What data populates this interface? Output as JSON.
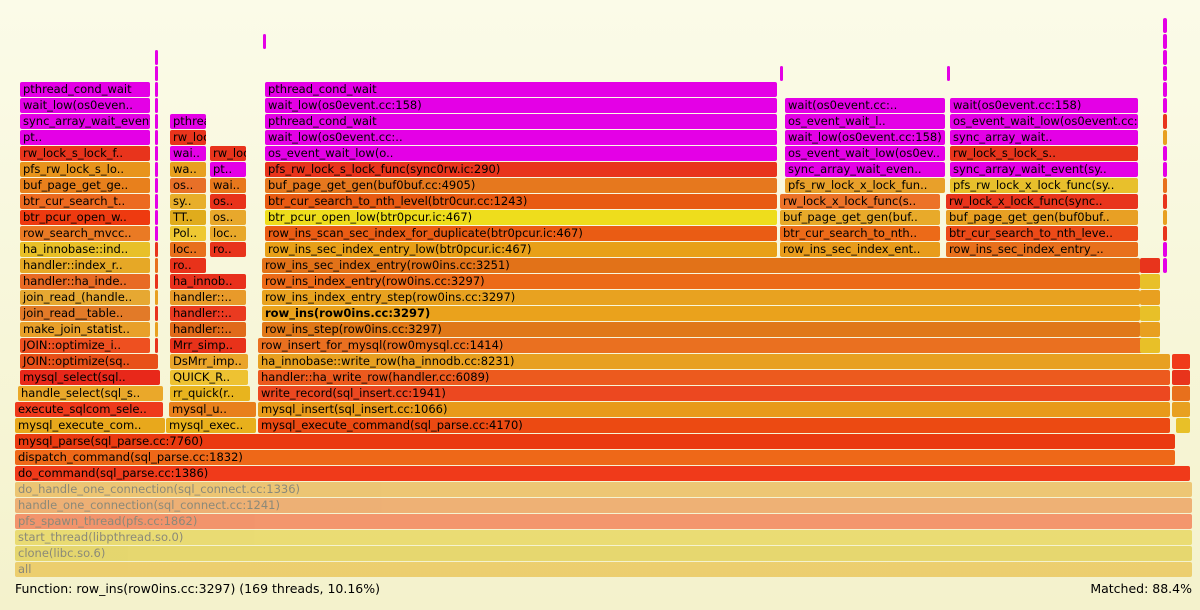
{
  "colors": {
    "magenta": "#e400e6",
    "red": "#e8341c",
    "orange_red": "#ef5a10",
    "orange": "#e8752c",
    "dark_orange": "#e06a12",
    "amber": "#e8a21e",
    "yellow": "#e8d020",
    "bright_red": "#f03822",
    "light_orange": "#e6964e"
  },
  "frames": [
    {
      "label": "all",
      "color": "#e6b020",
      "faded": true
    },
    {
      "label": "clone(libc.so.6)",
      "color": "#d8c020",
      "faded": true
    },
    {
      "label": "start_thread(libpthread.so.0)",
      "color": "#e0c828",
      "faded": true
    },
    {
      "label": "pfs_spawn_thread(pfs.cc:1862)",
      "color": "#f0481c",
      "faded": true
    },
    {
      "label": "handle_one_connection(sql_connect.cc:1241)",
      "color": "#e87a2a",
      "faded": true
    },
    {
      "label": "do_handle_one_connection(sql_connect.cc:1336)",
      "color": "#e6a028",
      "faded": true
    },
    {
      "label": "do_command(sql_parse.cc:1386)",
      "color": "#f03a1a"
    },
    {
      "label": "dispatch_command(sql_parse.cc:1832)",
      "color": "#ee6818"
    },
    {
      "label": "mysql_parse(sql_parse.cc:7760)",
      "color": "#ea3a10"
    },
    {
      "label": "mysql_execute_com..",
      "color": "#e8a81c"
    },
    {
      "label": "mysql_exec..",
      "color": "#e8b01c"
    },
    {
      "label": "mysql_execute_command(sql_parse.cc:4170)",
      "color": "#ec4a12"
    },
    {
      "label": "execute_sqlcom_sele..",
      "color": "#ee3a1c"
    },
    {
      "label": "mysql_u..",
      "color": "#e8801c"
    },
    {
      "label": "mysql_insert(sql_insert.cc:1066)",
      "color": "#e89a1a"
    },
    {
      "label": "handle_select(sql_s..",
      "color": "#eaa82a"
    },
    {
      "label": "rr_quick(r..",
      "color": "#e8b41e"
    },
    {
      "label": "write_record(sql_insert.cc:1941)",
      "color": "#ec4820"
    },
    {
      "label": "mysql_select(sql..",
      "color": "#e8281a"
    },
    {
      "label": "QUICK_R..",
      "color": "#eec232"
    },
    {
      "label": "handler::ha_write_row(handler.cc:6089)",
      "color": "#ec5a1e"
    },
    {
      "label": "JOIN::optimize(sq..",
      "color": "#e85018"
    },
    {
      "label": "DsMrr_imp..",
      "color": "#eaa42a"
    },
    {
      "label": "ha_innobase::write_row(ha_innodb.cc:8231)",
      "color": "#e8a020"
    },
    {
      "label": "JOIN::optimize_i..",
      "color": "#ee5020"
    },
    {
      "label": "Mrr_simp..",
      "color": "#e8321a"
    },
    {
      "label": "row_insert_for_mysql(row0mysql.cc:1414)",
      "color": "#ea7020"
    },
    {
      "label": "make_join_statist..",
      "color": "#e8a02a"
    },
    {
      "label": "handler::..",
      "color": "#e06a1a"
    },
    {
      "label": "row_ins_step(row0ins.cc:3297)",
      "color": "#e07818"
    },
    {
      "label": "join_read__table..",
      "color": "#e27a28"
    },
    {
      "label": "handler::..",
      "color": "#ea3a20"
    },
    {
      "label": "row_ins(row0ins.cc:3297)",
      "color": "#eaa21c",
      "bold": true
    },
    {
      "label": "join_read_(handle..",
      "color": "#e6a832"
    },
    {
      "label": "handler::..",
      "color": "#e89a2a"
    },
    {
      "label": "row_ins_index_entry_step(row0ins.cc:3297)",
      "color": "#e8a220"
    },
    {
      "label": "handler::ha_inde..",
      "color": "#e86a24"
    },
    {
      "label": "ha_innob..",
      "color": "#e8301c"
    },
    {
      "label": "row_ins_index_entry(row0ins.cc:3297)",
      "color": "#ec6a18"
    },
    {
      "label": "handler::index_r..",
      "color": "#e6a826"
    },
    {
      "label": "ro..",
      "color": "#e8321a"
    },
    {
      "label": "row_ins_sec_index_entry(row0ins.cc:3251)",
      "color": "#e27218"
    },
    {
      "label": "ha_innobase::ind..",
      "color": "#e8c028"
    },
    {
      "label": "loc..",
      "color": "#e8701c"
    },
    {
      "label": "ro..",
      "color": "#e8341c"
    },
    {
      "label": "row_ins_sec_index_entry_low(btr0pcur.ic:467)",
      "color": "#e8a018"
    },
    {
      "label": "row_ins_sec_index_ent..",
      "color": "#e89c1c"
    },
    {
      "label": "row_ins_sec_index_entry_..",
      "color": "#e8701c"
    },
    {
      "label": "row_search_mvcc..",
      "color": "#ea7a24"
    },
    {
      "label": "Pol..",
      "color": "#eec832"
    },
    {
      "label": "loc..",
      "color": "#e8a82a"
    },
    {
      "label": "row_ins_scan_sec_index_for_duplicate(btr0pcur.ic:467)",
      "color": "#ea5c14"
    },
    {
      "label": "btr_cur_search_to_nth..",
      "color": "#ec6a18"
    },
    {
      "label": "btr_cur_search_to_nth_leve..",
      "color": "#ec4a18"
    },
    {
      "label": "btr_pcur_open_w..",
      "color": "#ee3a10"
    },
    {
      "label": "TT..",
      "color": "#e0ac1c"
    },
    {
      "label": "os..",
      "color": "#e8a82c"
    },
    {
      "label": "btr_pcur_open_low(btr0pcur.ic:467)",
      "color": "#eedd1c"
    },
    {
      "label": "buf_page_get_gen(buf..",
      "color": "#e8aa2a"
    },
    {
      "label": "buf_page_get_gen(buf0buf..",
      "color": "#e8a024"
    },
    {
      "label": "btr_cur_search_t..",
      "color": "#ec6a20"
    },
    {
      "label": "sy..",
      "color": "#e8ae2a"
    },
    {
      "label": "os..",
      "color": "#e8321a"
    },
    {
      "label": "btr_cur_search_to_nth_level(btr0cur.cc:1243)",
      "color": "#e85a12"
    },
    {
      "label": "rw_lock_x_lock_func(s..",
      "color": "#ec7228"
    },
    {
      "label": "rw_lock_x_lock_func(sync..",
      "color": "#e8341c"
    },
    {
      "label": "buf_page_get_ge..",
      "color": "#e8801c"
    },
    {
      "label": "os..",
      "color": "#e87028"
    },
    {
      "label": "wai..",
      "color": "#e8781c"
    },
    {
      "label": "buf_page_get_gen(buf0buf.cc:4905)",
      "color": "#e6781e"
    },
    {
      "label": "pfs_rw_lock_x_lock_fun..",
      "color": "#e8a02a"
    },
    {
      "label": "pfs_rw_lock_x_lock_func(sy..",
      "color": "#e8c02c"
    },
    {
      "label": "pfs_rw_lock_s_lo..",
      "color": "#e8941c"
    },
    {
      "label": "wa..",
      "color": "#e8a020"
    },
    {
      "label": "pt..",
      "color": "#e400e6"
    },
    {
      "label": "pfs_rw_lock_s_lock_func(sync0rw.ic:290)",
      "color": "#e8341c"
    },
    {
      "label": "sync_array_wait_even..",
      "color": "#e400e6"
    },
    {
      "label": "sync_array_wait_event(sy..",
      "color": "#e400e6"
    },
    {
      "label": "rw_lock_s_lock_f..",
      "color": "#e8341c"
    },
    {
      "label": "wai..",
      "color": "#e400e6"
    },
    {
      "label": "rw_lock_s_lock_func(sync0rw.ic:290)",
      "color": "#e8341c"
    },
    {
      "label": "os_event_wait_low(o..",
      "color": "#e400e6"
    },
    {
      "label": "os_event_wait_low(os0ev..",
      "color": "#e400e6"
    },
    {
      "label": "rw_lock_s_lock_s..",
      "color": "#e8341c"
    },
    {
      "label": "pt..",
      "color": "#e400e6"
    },
    {
      "label": "rw_lock_s_lock_spin(sync0rw.cc:373)",
      "color": "#e8341c"
    },
    {
      "label": "wait_low(os0event.cc:..",
      "color": "#e400e6"
    },
    {
      "label": "wait_low(os0event.cc:158)",
      "color": "#e400e6"
    },
    {
      "label": "sync_array_wait..",
      "color": "#e400e6"
    },
    {
      "label": "sync_array_wait_event(sync0arr.cc:471)",
      "color": "#e400e6"
    },
    {
      "label": "pthread_cond_wait",
      "color": "#e400e6"
    },
    {
      "label": "pthread_cond_wait",
      "color": "#e400e6"
    },
    {
      "label": "os_event_wait_l..",
      "color": "#e400e6"
    },
    {
      "label": "os_event_wait_low(os0event.cc:158)",
      "color": "#e400e6"
    },
    {
      "label": "wait_low(os0even..",
      "color": "#e400e6"
    },
    {
      "label": "wait_low(os0event.cc:158)",
      "color": "#e400e6"
    },
    {
      "label": "wait(os0event.cc:..",
      "color": "#e400e6"
    },
    {
      "label": "wait(os0event.cc:158)",
      "color": "#e400e6"
    },
    {
      "label": "pthread_cond_wait",
      "color": "#e400e6"
    },
    {
      "label": "pthread_cond_wait",
      "color": "#e400e6"
    }
  ],
  "status": {
    "function": "Function: row_ins(row0ins.cc:3297) (169 threads, 10.16%)",
    "matched": "Matched: 88.4%"
  }
}
